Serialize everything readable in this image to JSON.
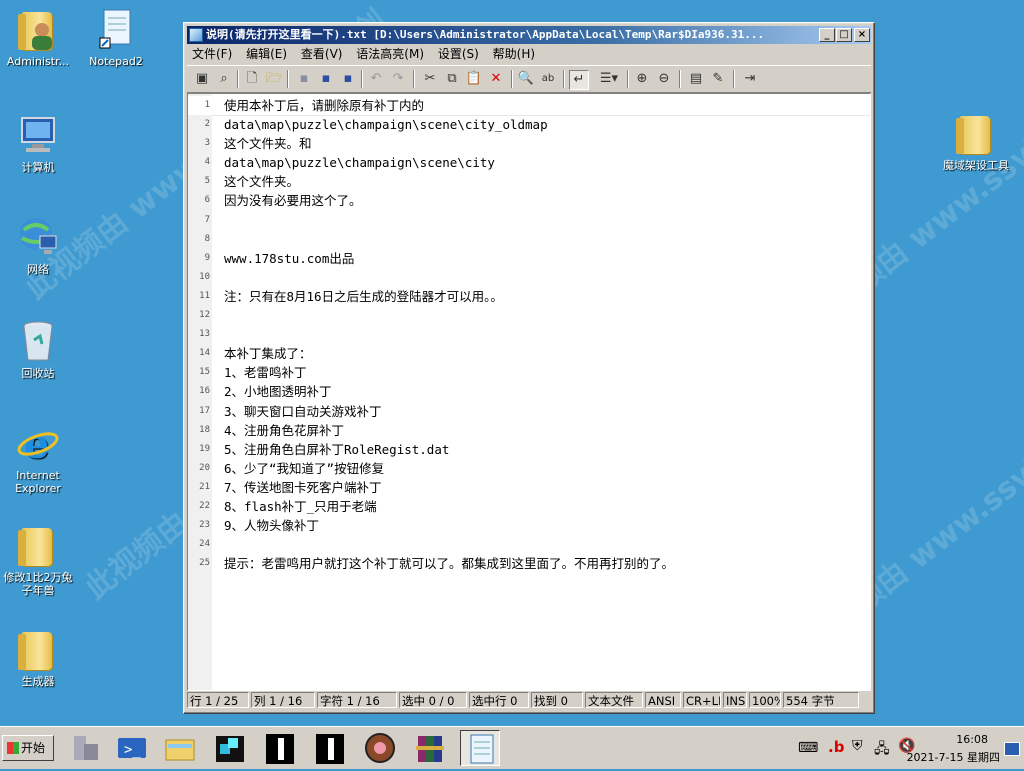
{
  "desktop": {
    "icons": [
      {
        "label": "Administr...",
        "icon": "user-folder-icon"
      },
      {
        "label": "Notepad2",
        "icon": "notepad-shortcut-icon"
      },
      {
        "label": "计算机",
        "icon": "computer-icon"
      },
      {
        "label": "网络",
        "icon": "network-icon"
      },
      {
        "label": "回收站",
        "icon": "recycle-bin-icon"
      },
      {
        "label": "Internet Explorer",
        "icon": "internet-explorer-icon"
      },
      {
        "label": "修改1比2万兔子年兽",
        "icon": "folder-icon"
      },
      {
        "label": "生成器",
        "icon": "folder-icon"
      },
      {
        "label": "魔域架设工具",
        "icon": "folder-icon"
      }
    ],
    "watermark": "此视频由 www.ssvip.net 原创"
  },
  "window": {
    "title": "说明(请先打开这里看一下).txt [D:\\Users\\Administrator\\AppData\\Local\\Temp\\Rar$DIa936.31...",
    "controls": {
      "minimize": "_",
      "maximize": "□",
      "close": "×"
    },
    "menu": [
      "文件(F)",
      "编辑(E)",
      "查看(V)",
      "语法高亮(M)",
      "设置(S)",
      "帮助(H)"
    ]
  },
  "editor": {
    "lines": [
      "使用本补丁后，请删除原有补丁内的",
      "data\\map\\puzzle\\champaign\\scene\\city_oldmap",
      "这个文件夹。和",
      "data\\map\\puzzle\\champaign\\scene\\city",
      "这个文件夹。",
      "因为没有必要用这个了。",
      "",
      "",
      "www.178stu.com出品",
      "",
      "注：只有在8月16日之后生成的登陆器才可以用。。",
      "",
      "",
      "本补丁集成了：",
      "1、老雷鸣补丁",
      "2、小地图透明补丁",
      "3、聊天窗口自动关游戏补丁",
      "4、注册角色花屏补丁",
      "5、注册角色白屏补丁RoleRegist.dat",
      "6、少了“我知道了”按钮修复",
      "7、传送地图卡死客户端补丁",
      "8、flash补丁_只用于老端",
      "9、人物头像补丁",
      "",
      "提示：老雷鸣用户就打这个补丁就可以了。都集成到这里面了。不用再打别的了。"
    ]
  },
  "status": {
    "line": "行 1 / 25",
    "col": "列 1 / 16",
    "char": "字符 1 / 16",
    "sel": "选中 0 / 0",
    "selline": "选中行 0",
    "found": "找到 0",
    "type": "文本文件",
    "encoding": "ANSI",
    "eol": "CR+LF",
    "ins": "INS",
    "zoom": "100%",
    "size": "554 字节"
  },
  "taskbar": {
    "start": "开始",
    "time": "16:08",
    "date": "2021-7-15 星期四"
  }
}
